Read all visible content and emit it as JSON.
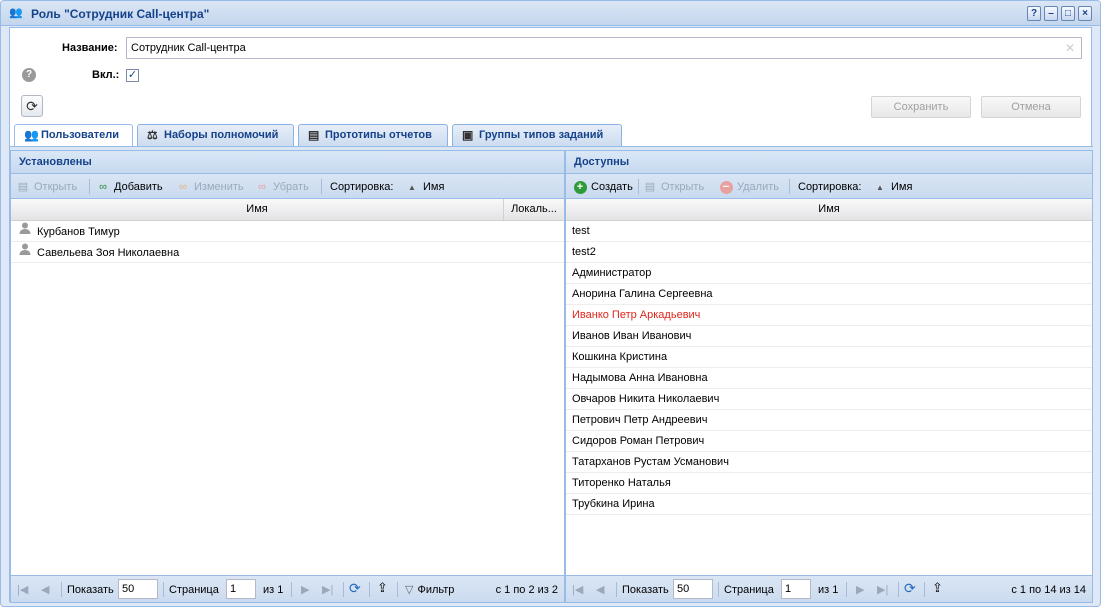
{
  "window": {
    "title": "Роль \"Сотрудник Call-центра\""
  },
  "form": {
    "name_label": "Название:",
    "name_value": "Сотрудник Call-центра",
    "enabled_label": "Вкл.:",
    "enabled_check": "✓",
    "save_label": "Сохранить",
    "cancel_label": "Отмена"
  },
  "tabs": [
    {
      "label": "Пользователи"
    },
    {
      "label": "Наборы полномочий"
    },
    {
      "label": "Прототипы отчетов"
    },
    {
      "label": "Группы типов заданий"
    }
  ],
  "left": {
    "title": "Установлены",
    "toolbar": {
      "open": "Открыть",
      "add": "Добавить",
      "edit": "Изменить",
      "remove": "Убрать",
      "sort_label": "Сортировка:",
      "sort_field": "Имя"
    },
    "columns": {
      "name": "Имя",
      "local": "Локаль..."
    },
    "rows": [
      "Курбанов Тимур",
      "Савельева Зоя Николаевна"
    ],
    "pager": {
      "show": "Показать",
      "page_size": "50",
      "page_label": "Страница",
      "page": "1",
      "of": "из 1",
      "filter": "Фильтр",
      "summary": "с 1 по 2 из 2"
    }
  },
  "right": {
    "title": "Доступны",
    "toolbar": {
      "create": "Создать",
      "open": "Открыть",
      "delete": "Удалить",
      "sort_label": "Сортировка:",
      "sort_field": "Имя"
    },
    "columns": {
      "name": "Имя"
    },
    "rows": [
      "test",
      "test2",
      "Администратор",
      "Анорина Галина Сергеевна",
      "Иванко Петр Аркадьевич",
      "Иванов Иван Иванович",
      "Кошкина Кристина",
      "Надымова Анна Ивановна",
      "Овчаров Никита Николаевич",
      "Петрович Петр Андреевич",
      "Сидоров Роман Петрович",
      "Татарханов Рустам Усманович",
      "Титоренко Наталья",
      "Трубкина Ирина"
    ],
    "highlight_color": "#e0261c",
    "pager": {
      "show": "Показать",
      "page_size": "50",
      "page_label": "Страница",
      "page": "1",
      "of": "из 1",
      "summary": "с 1 по 14 из 14"
    }
  },
  "icons": {
    "title": "users-icon",
    "help": "question-icon",
    "refresh": "refresh-icon"
  }
}
